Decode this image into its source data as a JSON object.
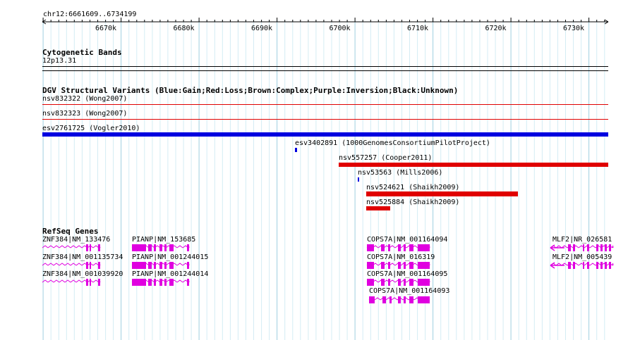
{
  "ruler": {
    "coord_label": "chr12:6661609..6734199",
    "ticks": [
      "6670k",
      "6680k",
      "6690k",
      "6700k",
      "6710k",
      "6720k",
      "6730k"
    ]
  },
  "cytoband": {
    "title": "Cytogenetic Bands",
    "band": "12p13.31"
  },
  "dgv": {
    "title": "DGV Structural Variants (Blue:Gain;Red:Loss;Brown:Complex;Purple:Inversion;Black:Unknown)",
    "colors": {
      "loss": "#e00000",
      "gain": "#0000e0"
    },
    "variants": [
      {
        "label": "nsv832322 (Wong2007)",
        "type": "loss"
      },
      {
        "label": "nsv832323 (Wong2007)",
        "type": "loss"
      },
      {
        "label": "esv2761725 (Vogler2010)",
        "type": "gain"
      },
      {
        "label": "esv3402891 (1000GenomesConsortiumPilotProject)",
        "type": "gain"
      },
      {
        "label": "nsv557257 (Cooper2011)",
        "type": "loss"
      },
      {
        "label": "nsv53563 (Mills2006)",
        "type": "gain"
      },
      {
        "label": "nsv524621 (Shaikh2009)",
        "type": "loss"
      },
      {
        "label": "nsv525884 (Shaikh2009)",
        "type": "loss"
      }
    ]
  },
  "refseq": {
    "title": "RefSeq Genes",
    "color": "#e000e0",
    "genes": [
      {
        "label": "ZNF384|NM_133476"
      },
      {
        "label": "ZNF384|NM_001135734"
      },
      {
        "label": "ZNF384|NM_001039920"
      },
      {
        "label": "PIANP|NM_153685"
      },
      {
        "label": "PIANP|NM_001244015"
      },
      {
        "label": "PIANP|NM_001244014"
      },
      {
        "label": "COPS7A|NM_001164094"
      },
      {
        "label": "COPS7A|NM_016319"
      },
      {
        "label": "COPS7A|NM_001164095"
      },
      {
        "label": "COPS7A|NM_001164093"
      },
      {
        "label": "MLF2|NR_026581"
      },
      {
        "label": "MLF2|NM_005439"
      }
    ]
  }
}
